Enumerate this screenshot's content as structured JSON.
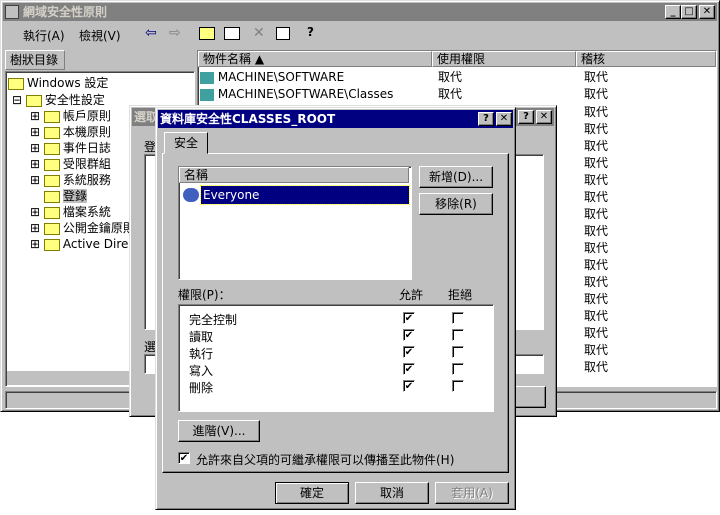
{
  "main": {
    "title": "網域安全性原則",
    "menu": {
      "action": "執行(A)",
      "view": "檢視(V)"
    },
    "tree_tab": "樹狀目錄",
    "tree": [
      "Windows 設定",
      "安全性設定",
      "帳戶原則",
      "本機原則",
      "事件日誌",
      "受限群組",
      "系統服務",
      "登錄",
      "檔案系統",
      "公開金鑰原則",
      "Active Directo"
    ],
    "list_headers": {
      "name": "物件名稱",
      "permission": "使用權限",
      "audit": "稽核"
    },
    "list_rows": [
      {
        "name": "MACHINE\\SOFTWARE",
        "permission": "取代",
        "audit": "取代"
      },
      {
        "name": "MACHINE\\SOFTWARE\\Classes",
        "permission": "取代",
        "audit": "取代"
      }
    ],
    "extra_audit": [
      "取代",
      "取代",
      "取代",
      "取代",
      "取代",
      "取代",
      "取代",
      "取代",
      "取代",
      "取代",
      "取代",
      "取代",
      "取代",
      "取代",
      "取代",
      "取代"
    ]
  },
  "middle": {
    "title": "選取",
    "label1": "登",
    "label2": "選"
  },
  "dialog": {
    "title": "資料庫安全性CLASSES_ROOT",
    "tab": "安全",
    "name_header": "名稱",
    "selected_user": "Everyone",
    "add_button": "新增(D)...",
    "remove_button": "移除(R)",
    "permissions_label": "權限(P)：",
    "allow_label": "允許",
    "deny_label": "拒絕",
    "permissions": [
      {
        "name": "完全控制",
        "allow": true,
        "deny": false
      },
      {
        "name": "讀取",
        "allow": true,
        "deny": false
      },
      {
        "name": "執行",
        "allow": true,
        "deny": false
      },
      {
        "name": "寫入",
        "allow": true,
        "deny": false
      },
      {
        "name": "刪除",
        "allow": true,
        "deny": false
      }
    ],
    "advanced_button": "進階(V)...",
    "inherit_label": "允許來自父項的可繼承權限可以傳播至此物件(H)",
    "ok": "確定",
    "cancel": "取消",
    "apply": "套用(A)"
  }
}
